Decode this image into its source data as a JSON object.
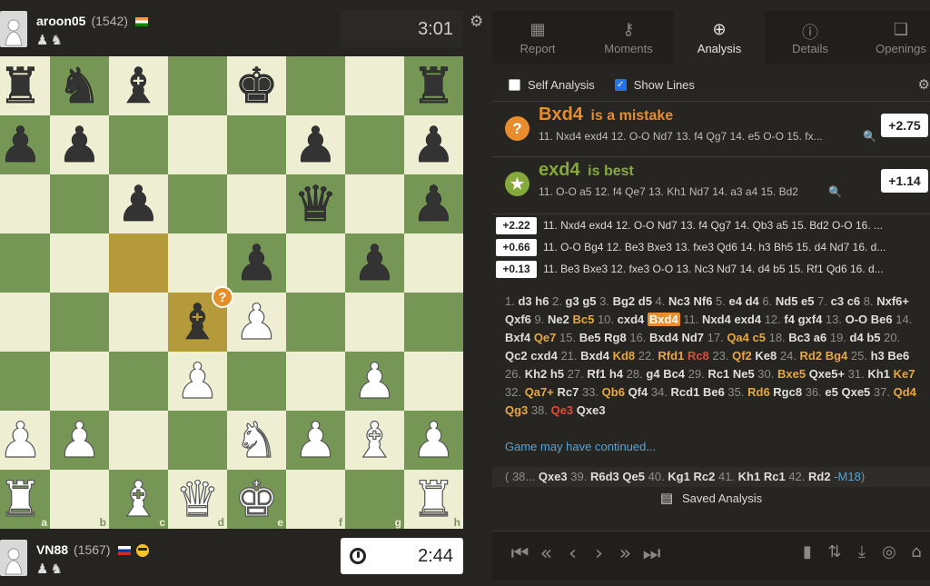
{
  "top_player": {
    "name": "aroon05",
    "rating": "(1542)",
    "flag": "india-flag",
    "captured": "♟♞",
    "clock": "3:01"
  },
  "bottom_player": {
    "name": "VN88",
    "rating": "(1567)",
    "flag": "russia-flag",
    "emoji": "sunglasses-emoji",
    "captured": "♟♞",
    "clock": "2:44"
  },
  "board": {
    "files": [
      "a",
      "b",
      "c",
      "d",
      "e",
      "f",
      "g",
      "h"
    ],
    "ranks": [
      "8",
      "7",
      "6",
      "5",
      "4",
      "3",
      "2",
      "1"
    ],
    "position": [
      [
        "bR",
        "bN",
        "bB",
        "",
        "bK",
        "",
        "",
        "bR"
      ],
      [
        "bP",
        "bP",
        "",
        "",
        "",
        "bP",
        "",
        "bP"
      ],
      [
        "",
        "",
        "bP",
        "",
        "",
        "bQ",
        "",
        "bP"
      ],
      [
        "",
        "",
        "",
        "",
        "bP",
        "",
        "bP",
        ""
      ],
      [
        "",
        "",
        "",
        "bB",
        "wP",
        "",
        "",
        ""
      ],
      [
        "",
        "",
        "",
        "wP",
        "",
        "",
        "wP",
        ""
      ],
      [
        "wP",
        "wP",
        "",
        "",
        "wN",
        "wP",
        "wB",
        "wP"
      ],
      [
        "wR",
        "",
        "wB",
        "wQ",
        "wK",
        "",
        "",
        "wR"
      ]
    ],
    "highlight_squares": [
      "c5",
      "d4"
    ],
    "mistake_square": "d4",
    "mistake_symbol": "?"
  },
  "tabs": [
    {
      "label": "Report",
      "icon": "report-icon"
    },
    {
      "label": "Moments",
      "icon": "key-icon"
    },
    {
      "label": "Analysis",
      "icon": "analysis-icon",
      "active": true
    },
    {
      "label": "Details",
      "icon": "info-icon"
    },
    {
      "label": "Openings",
      "icon": "book-icon"
    }
  ],
  "options": {
    "self_analysis": "Self Analysis",
    "self_analysis_checked": false,
    "show_lines": "Show Lines",
    "show_lines_checked": true
  },
  "mistake": {
    "move": "Bxd4",
    "verdict": "is a mistake",
    "line": "11. Nxd4 exd4 12. O-O Nd7 13. f4 Qg7 14. e5 O-O 15. fx...",
    "eval": "+2.75",
    "icon_symbol": "?"
  },
  "best": {
    "move": "exd4",
    "verdict": "is best",
    "line": "11. O-O a5 12. f4 Qe7 13. Kh1 Nd7 14. a3 a4 15. Bd2",
    "eval": "+1.14",
    "icon_symbol": "★"
  },
  "engine_lines": [
    {
      "eval": "+2.22",
      "text": "11. Nxd4 exd4 12. O-O Nd7 13. f4 Qg7 14. Qb3 a5 15. Bd2 O-O 16. ..."
    },
    {
      "eval": "+0.66",
      "text": "11. O-O Bg4 12. Be3 Bxe3 13. fxe3 Qd6 14. h3 Bh5 15. d4 Nd7 16. d..."
    },
    {
      "eval": "+0.13",
      "text": "11. Be3 Bxe3 12. fxe3 O-O 13. Nc3 Nd7 14. d4 b5 15. Rf1 Qd6 16. d..."
    }
  ],
  "moves": [
    {
      "n": "1.",
      "w": "d3",
      "b": "h6"
    },
    {
      "n": "2.",
      "w": "g3",
      "b": "g5"
    },
    {
      "n": "3.",
      "w": "Bg2",
      "b": "d5"
    },
    {
      "n": "4.",
      "w": "Nc3",
      "b": "Nf6"
    },
    {
      "n": "5.",
      "w": "e4",
      "b": "d4"
    },
    {
      "n": "6.",
      "w": "Nd5",
      "b": "e5"
    },
    {
      "n": "7.",
      "w": "c3",
      "b": "c6"
    },
    {
      "n": "8.",
      "w": "Nxf6+",
      "b": "Qxf6"
    },
    {
      "n": "9.",
      "w": "Ne2",
      "b": "Bc5",
      "bs": "o"
    },
    {
      "n": "10.",
      "w": "cxd4",
      "b": "Bxd4",
      "bs": "sel"
    },
    {
      "n": "11.",
      "w": "Nxd4",
      "b": "exd4"
    },
    {
      "n": "12.",
      "w": "f4",
      "b": "gxf4"
    },
    {
      "n": "13.",
      "w": "O-O",
      "b": "Be6"
    },
    {
      "n": "14.",
      "w": "Bxf4",
      "b": "Qe7",
      "bs": "o"
    },
    {
      "n": "15.",
      "w": "Be5",
      "b": "Rg8"
    },
    {
      "n": "16.",
      "w": "Bxd4",
      "b": "Nd7"
    },
    {
      "n": "17.",
      "w": "Qa4",
      "ws": "o",
      "b": "c5",
      "bs": "o"
    },
    {
      "n": "18.",
      "w": "Bc3",
      "b": "a6"
    },
    {
      "n": "19.",
      "w": "d4",
      "b": "b5"
    },
    {
      "n": "20.",
      "w": "Qc2",
      "b": "cxd4"
    },
    {
      "n": "21.",
      "w": "Bxd4",
      "b": "Kd8",
      "bs": "o"
    },
    {
      "n": "22.",
      "w": "Rfd1",
      "ws": "o",
      "b": "Rc8",
      "bs": "r"
    },
    {
      "n": "23.",
      "w": "Qf2",
      "ws": "o",
      "b": "Ke8"
    },
    {
      "n": "24.",
      "w": "Rd2",
      "ws": "o",
      "b": "Bg4",
      "bs": "o"
    },
    {
      "n": "25.",
      "w": "h3",
      "b": "Be6"
    },
    {
      "n": "26.",
      "w": "Kh2",
      "b": "h5"
    },
    {
      "n": "27.",
      "w": "Rf1",
      "b": "h4"
    },
    {
      "n": "28.",
      "w": "g4",
      "b": "Bc4"
    },
    {
      "n": "29.",
      "w": "Rc1",
      "b": "Ne5"
    },
    {
      "n": "30.",
      "w": "Bxe5",
      "ws": "o",
      "b": "Qxe5+"
    },
    {
      "n": "31.",
      "w": "Kh1",
      "b": "Ke7",
      "bs": "o"
    },
    {
      "n": "32.",
      "w": "Qa7+",
      "ws": "o",
      "b": "Rc7"
    },
    {
      "n": "33.",
      "w": "Qb6",
      "ws": "o",
      "b": "Qf4"
    },
    {
      "n": "34.",
      "w": "Rcd1",
      "b": "Be6"
    },
    {
      "n": "35.",
      "w": "Rd6",
      "ws": "o",
      "b": "Rgc8"
    },
    {
      "n": "36.",
      "w": "e5",
      "b": "Qxe5"
    },
    {
      "n": "37.",
      "w": "Qd4",
      "ws": "o",
      "b": "Qg3",
      "bs": "o"
    },
    {
      "n": "38.",
      "w": "Qe3",
      "ws": "r",
      "b": "Qxe3"
    }
  ],
  "game_continued": "Game may have continued...",
  "continuation": {
    "prefix": "( 38...",
    "moves": [
      {
        "n": "",
        "w": "",
        "b": "Qxe3"
      },
      {
        "n": "39.",
        "w": "R6d3",
        "b": "Qe5"
      },
      {
        "n": "40.",
        "w": "Kg1",
        "b": "Rc2"
      },
      {
        "n": "41.",
        "w": "Kh1",
        "b": "Rc1"
      },
      {
        "n": "42.",
        "w": "Rd2",
        "b": ""
      }
    ],
    "mate": "-M18",
    "suffix": ")"
  },
  "saved_analysis": "Saved Analysis",
  "nav_icons": [
    "first-move-icon",
    "previous-fast-icon",
    "previous-move-icon",
    "next-move-icon",
    "next-fast-icon",
    "last-move-icon"
  ],
  "tool_icons": [
    "graph-icon",
    "flip-board-icon",
    "download-icon",
    "engine-icon",
    "share-icon"
  ]
}
